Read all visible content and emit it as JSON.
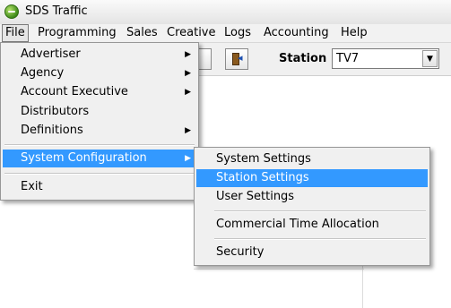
{
  "window": {
    "title": "SDS Traffic",
    "icon": "app-logo-icon"
  },
  "menubar": [
    "File",
    "Programming",
    "Sales",
    "Creative",
    "Logs",
    "Accounting",
    "Help"
  ],
  "toolbar": {
    "station_label": "Station :",
    "station_value": "TV7"
  },
  "file_menu": {
    "items": [
      "Advertiser",
      "Agency",
      "Account Executive",
      "Distributors",
      "Definitions"
    ],
    "system_configuration": "System Configuration",
    "exit": "Exit"
  },
  "system_config_menu": {
    "system_settings": "System Settings",
    "station_settings": "Station Settings",
    "user_settings": "User Settings",
    "commercial_time_allocation": "Commercial Time Allocation",
    "security": "Security"
  },
  "colors": {
    "highlight": "#3399ff",
    "menu_bg": "#f0f0f0"
  }
}
